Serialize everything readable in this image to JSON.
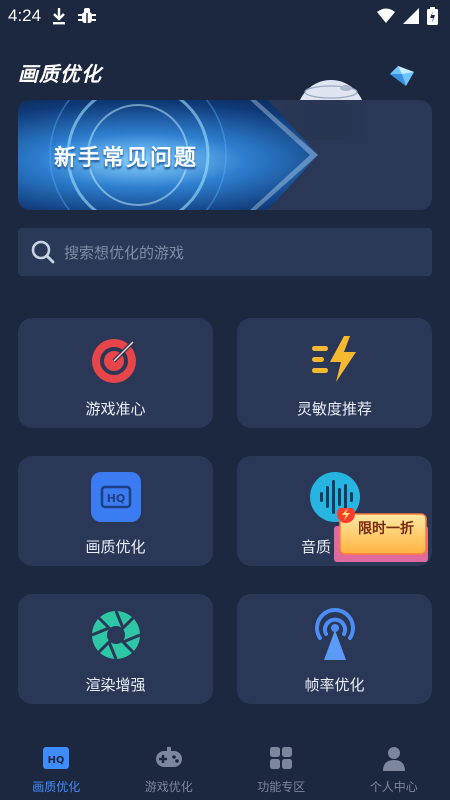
{
  "status_bar": {
    "time": "4:24"
  },
  "header": {
    "title": "画质优化"
  },
  "banner": {
    "text": "新手常见问题"
  },
  "search": {
    "placeholder": "搜索想优化的游戏"
  },
  "cards": [
    {
      "label": "游戏准心",
      "icon": "crosshair-target-icon"
    },
    {
      "label": "灵敏度推荐",
      "icon": "lightning-sensitivity-icon"
    },
    {
      "label": "画质优化",
      "icon": "hq-icon"
    },
    {
      "label": "音质",
      "icon": "sound-wave-icon"
    },
    {
      "label": "渲染增强",
      "icon": "aperture-icon"
    },
    {
      "label": "帧率优化",
      "icon": "broadcast-tower-icon"
    }
  ],
  "promo": {
    "label": "限时一折"
  },
  "bottom_nav": [
    {
      "label": "画质优化",
      "icon": "hq-icon",
      "active": true
    },
    {
      "label": "游戏优化",
      "icon": "gamepad-icon",
      "active": false
    },
    {
      "label": "功能专区",
      "icon": "grid-icon",
      "active": false
    },
    {
      "label": "个人中心",
      "icon": "person-icon",
      "active": false
    }
  ],
  "colors": {
    "background": "#1c2740",
    "card": "#2a3756",
    "accent": "#3f8cff",
    "nav_inactive": "#7c879d"
  }
}
